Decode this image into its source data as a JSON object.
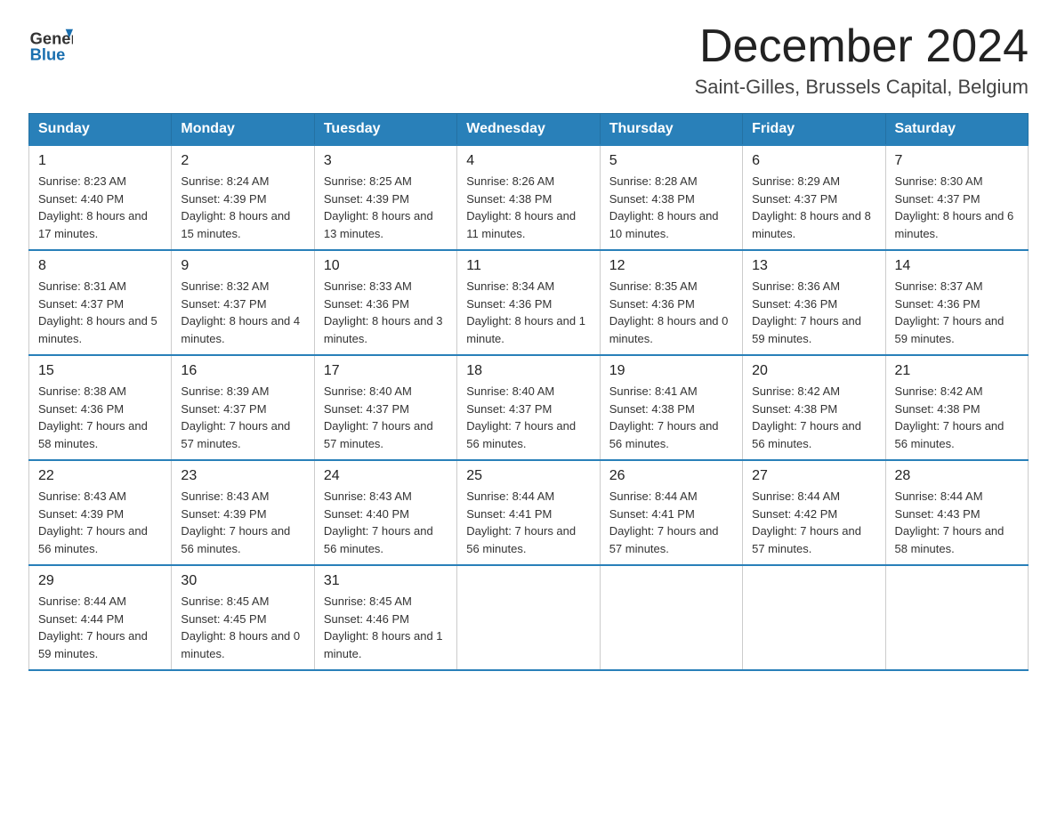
{
  "header": {
    "month_title": "December 2024",
    "location": "Saint-Gilles, Brussels Capital, Belgium",
    "logo_general": "General",
    "logo_blue": "Blue"
  },
  "weekdays": [
    "Sunday",
    "Monday",
    "Tuesday",
    "Wednesday",
    "Thursday",
    "Friday",
    "Saturday"
  ],
  "weeks": [
    [
      {
        "day": "1",
        "sunrise": "8:23 AM",
        "sunset": "4:40 PM",
        "daylight": "8 hours and 17 minutes."
      },
      {
        "day": "2",
        "sunrise": "8:24 AM",
        "sunset": "4:39 PM",
        "daylight": "8 hours and 15 minutes."
      },
      {
        "day": "3",
        "sunrise": "8:25 AM",
        "sunset": "4:39 PM",
        "daylight": "8 hours and 13 minutes."
      },
      {
        "day": "4",
        "sunrise": "8:26 AM",
        "sunset": "4:38 PM",
        "daylight": "8 hours and 11 minutes."
      },
      {
        "day": "5",
        "sunrise": "8:28 AM",
        "sunset": "4:38 PM",
        "daylight": "8 hours and 10 minutes."
      },
      {
        "day": "6",
        "sunrise": "8:29 AM",
        "sunset": "4:37 PM",
        "daylight": "8 hours and 8 minutes."
      },
      {
        "day": "7",
        "sunrise": "8:30 AM",
        "sunset": "4:37 PM",
        "daylight": "8 hours and 6 minutes."
      }
    ],
    [
      {
        "day": "8",
        "sunrise": "8:31 AM",
        "sunset": "4:37 PM",
        "daylight": "8 hours and 5 minutes."
      },
      {
        "day": "9",
        "sunrise": "8:32 AM",
        "sunset": "4:37 PM",
        "daylight": "8 hours and 4 minutes."
      },
      {
        "day": "10",
        "sunrise": "8:33 AM",
        "sunset": "4:36 PM",
        "daylight": "8 hours and 3 minutes."
      },
      {
        "day": "11",
        "sunrise": "8:34 AM",
        "sunset": "4:36 PM",
        "daylight": "8 hours and 1 minute."
      },
      {
        "day": "12",
        "sunrise": "8:35 AM",
        "sunset": "4:36 PM",
        "daylight": "8 hours and 0 minutes."
      },
      {
        "day": "13",
        "sunrise": "8:36 AM",
        "sunset": "4:36 PM",
        "daylight": "7 hours and 59 minutes."
      },
      {
        "day": "14",
        "sunrise": "8:37 AM",
        "sunset": "4:36 PM",
        "daylight": "7 hours and 59 minutes."
      }
    ],
    [
      {
        "day": "15",
        "sunrise": "8:38 AM",
        "sunset": "4:36 PM",
        "daylight": "7 hours and 58 minutes."
      },
      {
        "day": "16",
        "sunrise": "8:39 AM",
        "sunset": "4:37 PM",
        "daylight": "7 hours and 57 minutes."
      },
      {
        "day": "17",
        "sunrise": "8:40 AM",
        "sunset": "4:37 PM",
        "daylight": "7 hours and 57 minutes."
      },
      {
        "day": "18",
        "sunrise": "8:40 AM",
        "sunset": "4:37 PM",
        "daylight": "7 hours and 56 minutes."
      },
      {
        "day": "19",
        "sunrise": "8:41 AM",
        "sunset": "4:38 PM",
        "daylight": "7 hours and 56 minutes."
      },
      {
        "day": "20",
        "sunrise": "8:42 AM",
        "sunset": "4:38 PM",
        "daylight": "7 hours and 56 minutes."
      },
      {
        "day": "21",
        "sunrise": "8:42 AM",
        "sunset": "4:38 PM",
        "daylight": "7 hours and 56 minutes."
      }
    ],
    [
      {
        "day": "22",
        "sunrise": "8:43 AM",
        "sunset": "4:39 PM",
        "daylight": "7 hours and 56 minutes."
      },
      {
        "day": "23",
        "sunrise": "8:43 AM",
        "sunset": "4:39 PM",
        "daylight": "7 hours and 56 minutes."
      },
      {
        "day": "24",
        "sunrise": "8:43 AM",
        "sunset": "4:40 PM",
        "daylight": "7 hours and 56 minutes."
      },
      {
        "day": "25",
        "sunrise": "8:44 AM",
        "sunset": "4:41 PM",
        "daylight": "7 hours and 56 minutes."
      },
      {
        "day": "26",
        "sunrise": "8:44 AM",
        "sunset": "4:41 PM",
        "daylight": "7 hours and 57 minutes."
      },
      {
        "day": "27",
        "sunrise": "8:44 AM",
        "sunset": "4:42 PM",
        "daylight": "7 hours and 57 minutes."
      },
      {
        "day": "28",
        "sunrise": "8:44 AM",
        "sunset": "4:43 PM",
        "daylight": "7 hours and 58 minutes."
      }
    ],
    [
      {
        "day": "29",
        "sunrise": "8:44 AM",
        "sunset": "4:44 PM",
        "daylight": "7 hours and 59 minutes."
      },
      {
        "day": "30",
        "sunrise": "8:45 AM",
        "sunset": "4:45 PM",
        "daylight": "8 hours and 0 minutes."
      },
      {
        "day": "31",
        "sunrise": "8:45 AM",
        "sunset": "4:46 PM",
        "daylight": "8 hours and 1 minute."
      },
      null,
      null,
      null,
      null
    ]
  ]
}
